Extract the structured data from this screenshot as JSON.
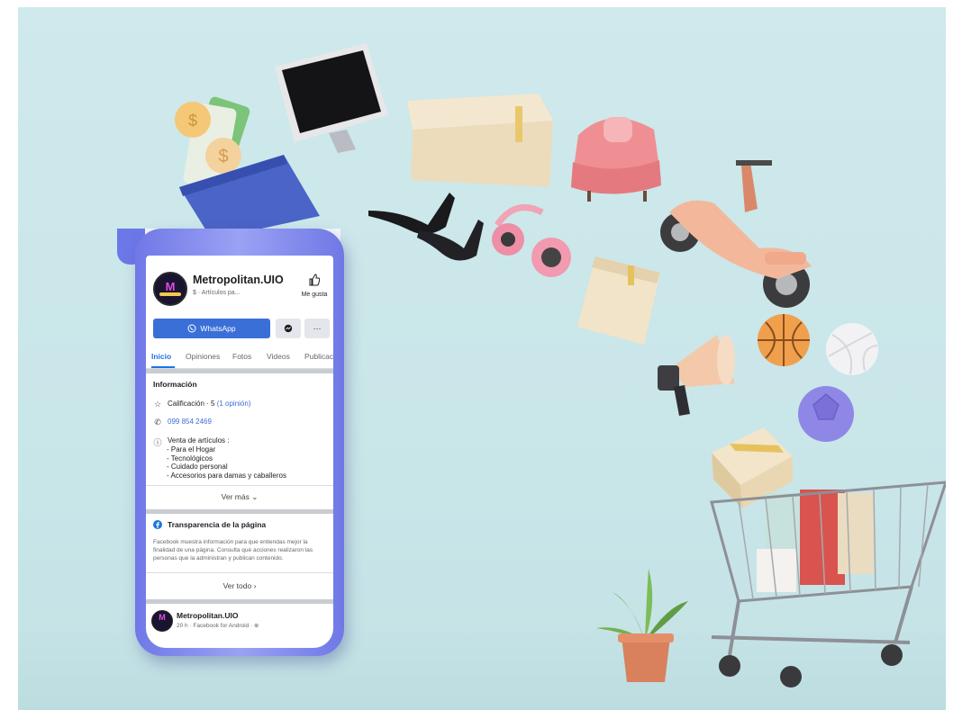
{
  "page": {
    "name": "Metropolitan.UIO",
    "category": "$ · Artículos pa...",
    "like_label": "Me gusta"
  },
  "actions": {
    "whatsapp_label": "WhatsApp",
    "messenger_icon": "messenger-icon",
    "more_label": "···"
  },
  "tabs": [
    "Inicio",
    "Opiniones",
    "Fotos",
    "Videos",
    "Publicac"
  ],
  "info": {
    "title": "Información",
    "rating_label": "Calificación · 5 ",
    "rating_link": "(1 opinión)",
    "phone": "099 854 2469",
    "description_title": "Venta de artículos :",
    "description_items": [
      "- Para el Hogar",
      "- Tecnológicos",
      "- Cuidado personal",
      "- Accesorios para damas y caballeros"
    ],
    "see_more": "Ver más ⌄"
  },
  "transparency": {
    "title": "Transparencia de la página",
    "body": "Facebook muestra información para que entiendas mejor la finalidad de una página. Consulta qué acciones realizaron las personas que la administran y publican contenido.",
    "see_all": "Ver todo  ›"
  },
  "post": {
    "name": "Metropolitan.UIO",
    "meta": "20 h · Facebook for Android · ⊕"
  },
  "colors": {
    "background": "#cfe9ec",
    "phone_frame": "#7b83ec",
    "fb_blue": "#1b74e4",
    "whatsapp_button": "#3b6fd8"
  }
}
